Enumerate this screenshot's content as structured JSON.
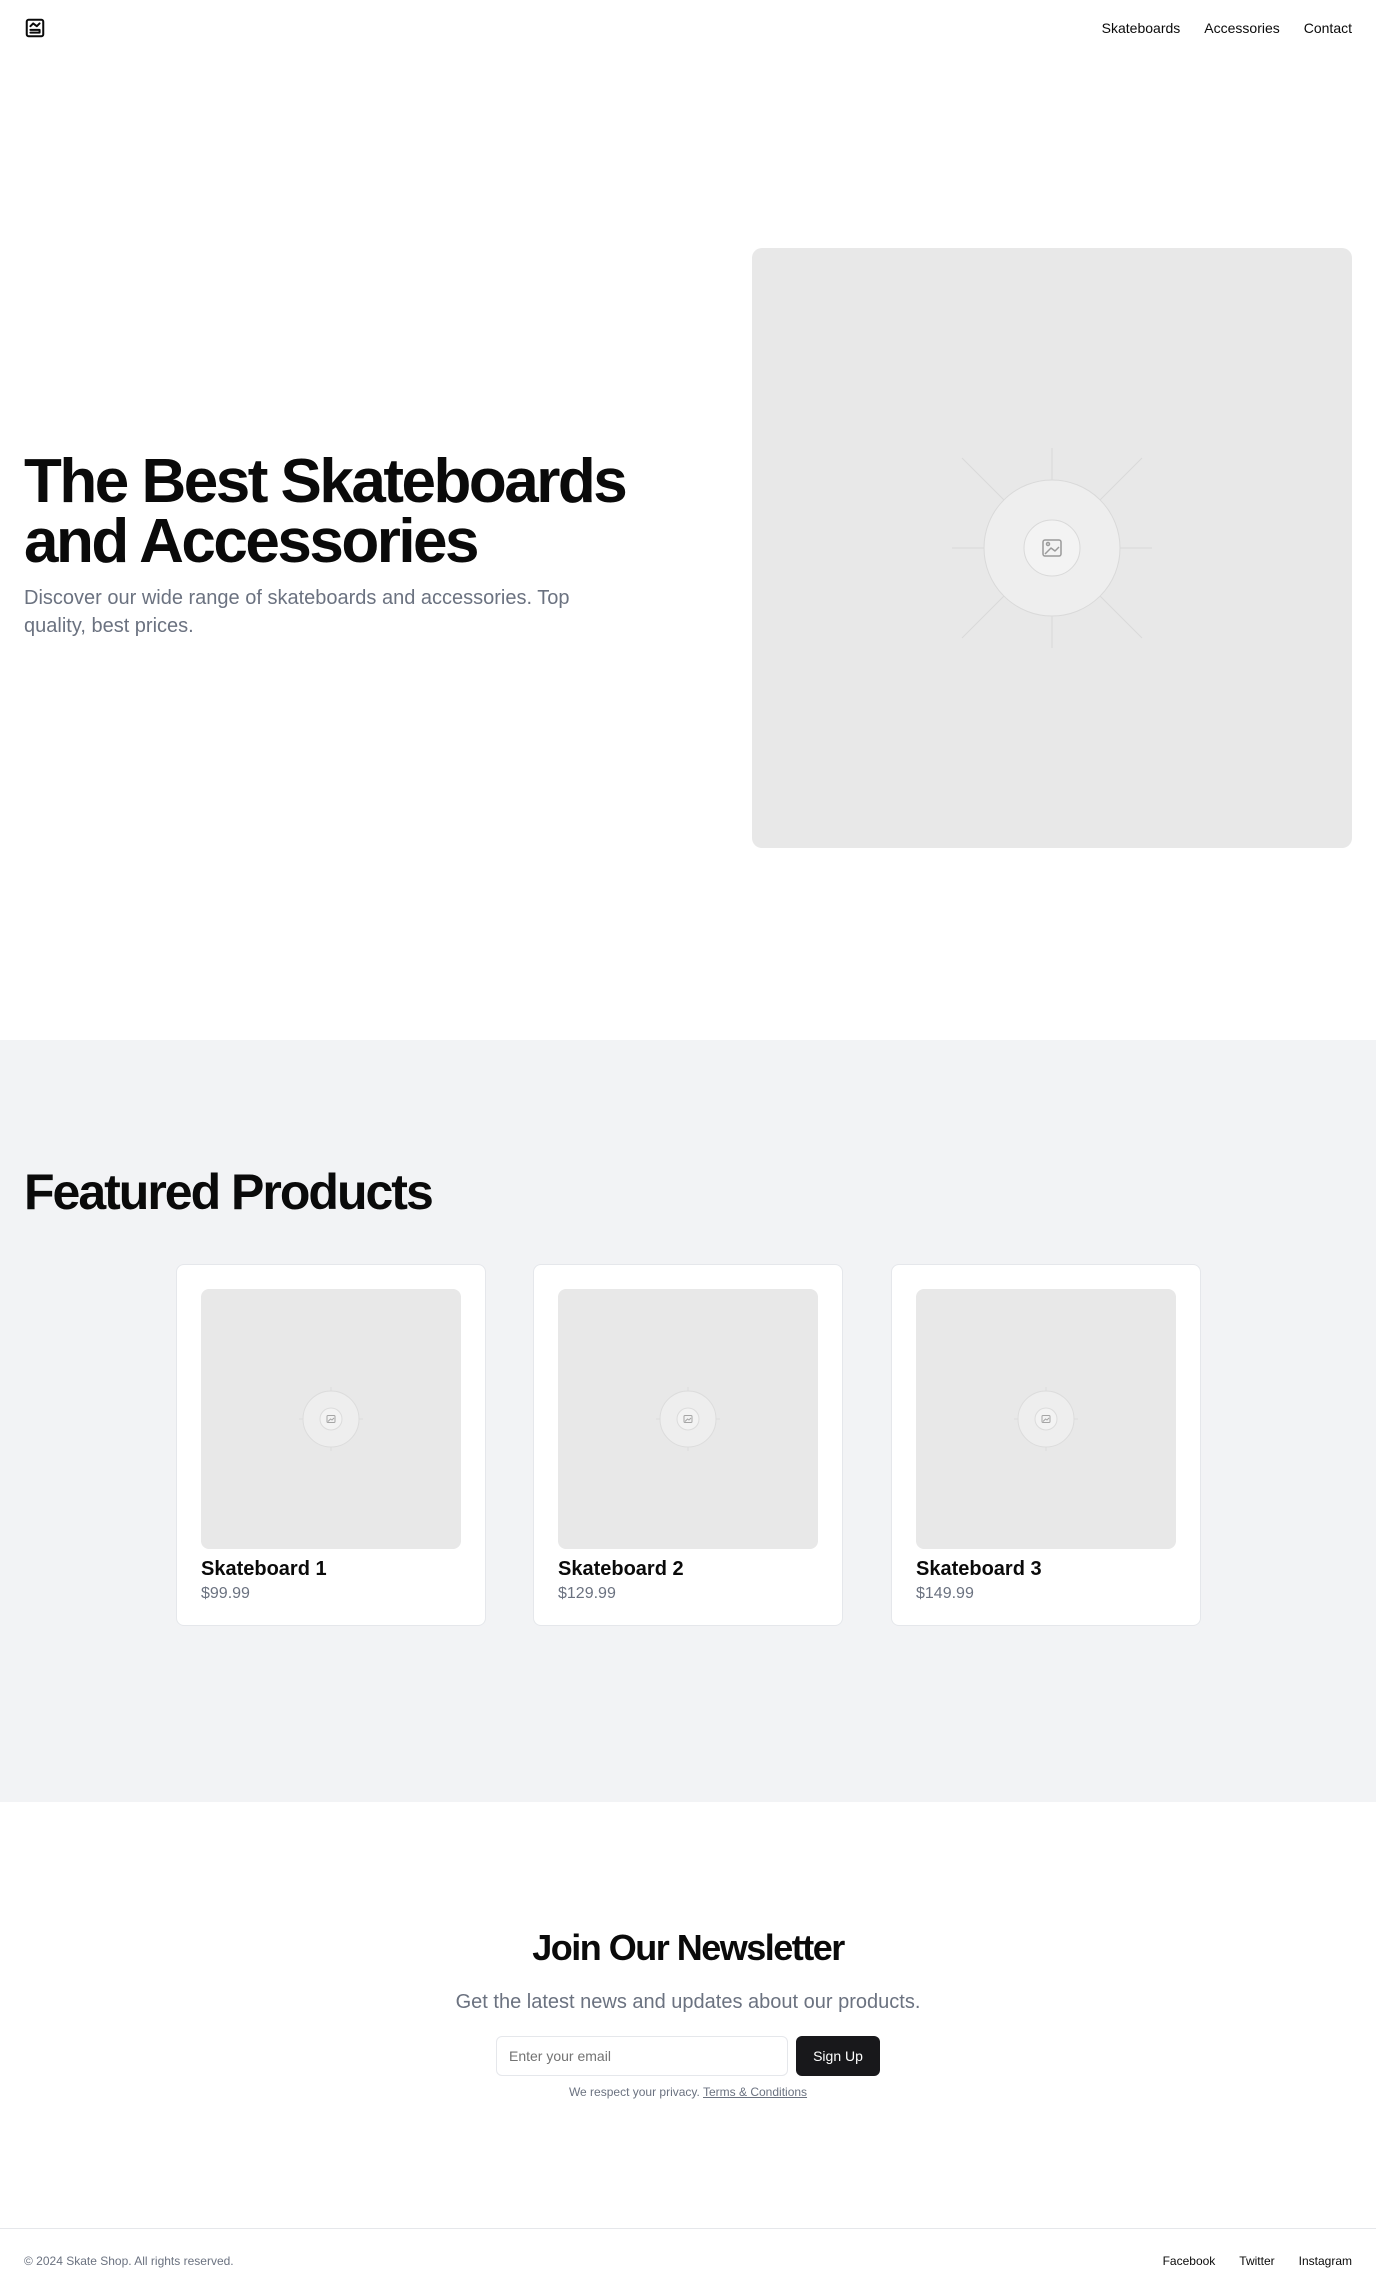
{
  "header": {
    "logo_icon": "mountain-logo-icon",
    "nav": [
      "Skateboards",
      "Accessories",
      "Contact"
    ]
  },
  "hero": {
    "title": "The Best Skateboards and Accessories",
    "subtitle": "Discover our wide range of skateboards and accessories. Top quality, best prices.",
    "image_icon": "image-placeholder-icon"
  },
  "featured": {
    "title": "Featured Products",
    "products": [
      {
        "name": "Skateboard 1",
        "price": "$99.99"
      },
      {
        "name": "Skateboard 2",
        "price": "$129.99"
      },
      {
        "name": "Skateboard 3",
        "price": "$149.99"
      }
    ]
  },
  "newsletter": {
    "title": "Join Our Newsletter",
    "subtitle": "Get the latest news and updates about our products.",
    "placeholder": "Enter your email",
    "button": "Sign Up",
    "note": "We respect your privacy.",
    "terms_link": "Terms & Conditions"
  },
  "footer": {
    "copyright": "© 2024 Skate Shop. All rights reserved.",
    "links": [
      "Facebook",
      "Twitter",
      "Instagram"
    ]
  },
  "colors": {
    "background": "#ffffff",
    "section_gray": "#f2f3f5",
    "placeholder": "#e8e8e8",
    "muted_text": "#6b7280",
    "button": "#18181b"
  }
}
